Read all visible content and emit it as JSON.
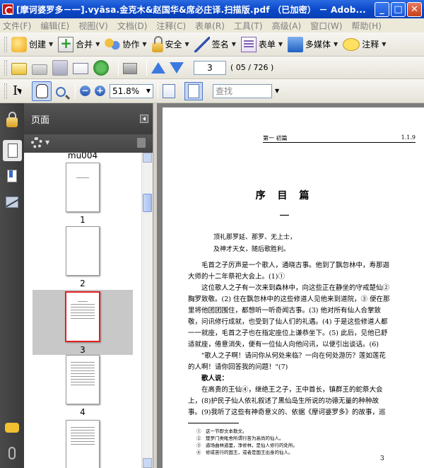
{
  "window": {
    "title": "[摩诃婆罗多－一].vyāsa.金克木&赵国华&席必庄译.扫描版.pdf （已加密） － Adob...",
    "minimize": "_",
    "maximize": "□",
    "close": "✕"
  },
  "menu": [
    "文件(F)",
    "编辑(E)",
    "视图(V)",
    "文档(D)",
    "注释(C)",
    "表单(R)",
    "工具(T)",
    "高级(A)",
    "窗口(W)",
    "帮助(H)"
  ],
  "toolbar1": {
    "create": "创建",
    "combine": "合并",
    "collaborate": "协作",
    "secure": "安全",
    "sign": "签名",
    "forms": "表单",
    "multimedia": "多媒体",
    "comment": "注释"
  },
  "toolbar2": {
    "page_number": "3",
    "page_count": "( 05 / 726 )"
  },
  "toolbar3": {
    "zoom": "51.8%",
    "find_placeholder": "查找"
  },
  "panel": {
    "title": "页面",
    "top_label": "mu004",
    "thumbnails": [
      {
        "number": "1",
        "selected": false
      },
      {
        "number": "2",
        "selected": false
      },
      {
        "number": "3",
        "selected": true
      },
      {
        "number": "4",
        "selected": false
      }
    ]
  },
  "document": {
    "running_head_center": "第一  初篇",
    "running_head_right": "1.1.9",
    "heading": "序 目 篇",
    "section": "一",
    "verses": [
      "顶礼那罗延、那罗、无上士，",
      "及神才天女，随后歌胜利。"
    ],
    "paragraphs": [
      "　　毛首之子厉声是一个歌人，通晓古事。他到了飘忽林中，寿那迦",
      "大师的十二年祭祀大会上。(1)①",
      "　　这位歌人之子有一次来到森林中，向这些正在静坐的守戒楚仙②",
      "胸罗致敬。(2) 住在飘忽林中的这些修道人见他来到道院，③ 便在那",
      "里将他团团围住，都想听一听奇闻古事。(3) 他对所有仙人合掌致",
      "敬，问讯修行成就，也受到了仙人们的礼遇。(4) 于是这些修道人都",
      "一一就座，毛首之子也在指定座位上谦恭坐下。(5) 此后，见他已舒",
      "适就座，倦意消失，便有一位仙人向他问讯，以便引出谈话。(6)",
      "　　\"歌人之子啊！请问你从何处来临？一向在何处游历？莲如莲花",
      "的人啊！请你回答我的问题！\"(7)",
      "　　歌人说：",
      "　　在高贵的王仙④，继绝王之子，王中首长，镇群王的蛇祭大会",
      "上，(8)护民子仙人依礼叙述了黑仙岛生所说的功德无量的种种故",
      "事。(9)我听了这些有神奇意义的、依据《摩诃婆罗多》的故事，巡"
    ],
    "footnotes": [
      "①　这一节即文本散文。",
      "②　楚罗门类毗舍所谓行苦为高尚的仙人。",
      "③　道场曲林道里，净修林，是仙人修行的处所。",
      "④　修成苦行的国王，或者是国王出身的仙人。"
    ],
    "page_number": "3"
  }
}
